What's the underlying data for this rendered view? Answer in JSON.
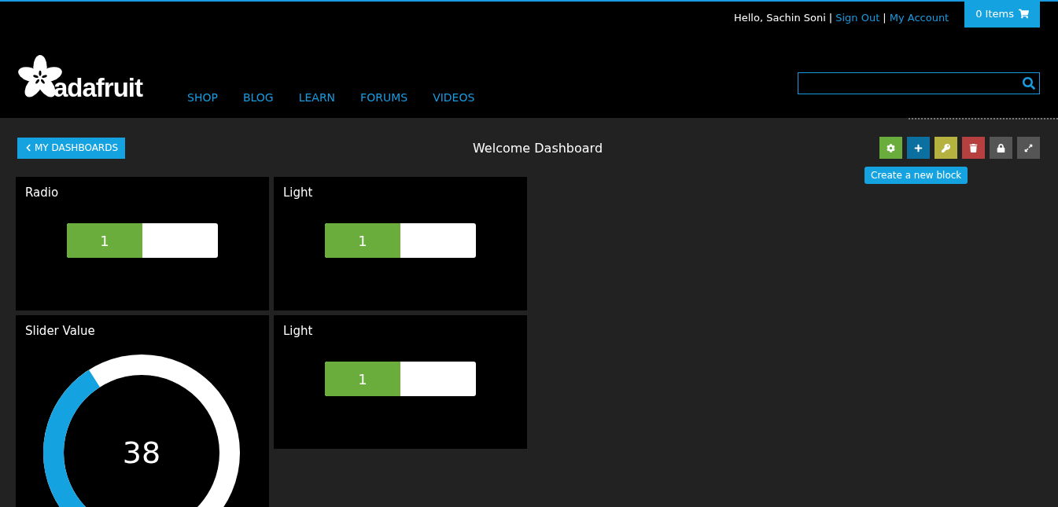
{
  "top_bar": {
    "greeting": "Hello, Sachin Soni",
    "separator_1": "|",
    "sign_out": "Sign Out",
    "separator_2": "|",
    "account": "My Account",
    "cart": "0 Items"
  },
  "logo": {
    "text": "adafruit"
  },
  "nav": [
    "SHOP",
    "BLOG",
    "LEARN",
    "FORUMS",
    "VIDEOS"
  ],
  "dashboard": {
    "back": "MY DASHBOARDS",
    "title": "Welcome Dashboard",
    "tools": [
      {
        "kind": "settings",
        "color": "#6aad3d"
      },
      {
        "kind": "add",
        "color": "#0b6fa0"
      },
      {
        "kind": "key",
        "color": "#b5b240"
      },
      {
        "kind": "delete",
        "color": "#b5403f"
      },
      {
        "kind": "lock",
        "color": "#555555"
      },
      {
        "kind": "expand",
        "color": "#555555"
      }
    ],
    "tooltip": "Create a new block"
  },
  "blocks": [
    {
      "kind": "toggle",
      "title": "Radio",
      "value": "1",
      "on": true
    },
    {
      "kind": "toggle",
      "title": "Light",
      "value": "1",
      "on": true
    },
    {
      "kind": "gauge",
      "title": "Slider Value",
      "value": "38"
    },
    {
      "kind": "toggle",
      "title": "Light",
      "value": "1",
      "on": true
    }
  ]
}
